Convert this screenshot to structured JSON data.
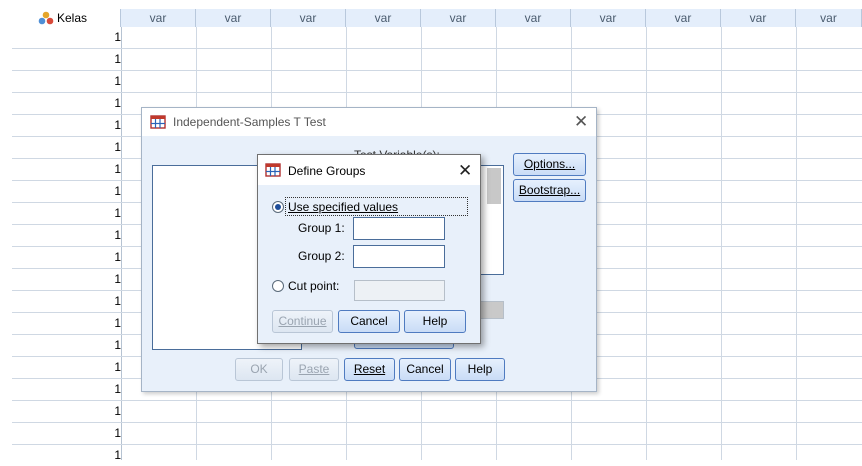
{
  "sheet": {
    "first_column_header": "Kelas",
    "first_column_icon": "nominal-variable-icon",
    "empty_column_headers": [
      "var",
      "var",
      "var",
      "var",
      "var",
      "var",
      "var",
      "var",
      "var",
      "var"
    ],
    "row_values": [
      "1",
      "1",
      "1",
      "1",
      "1",
      "1",
      "1",
      "1",
      "1",
      "1",
      "1",
      "1",
      "1",
      "1",
      "1",
      "1",
      "1",
      "1",
      "1",
      "1"
    ]
  },
  "main_dialog": {
    "title": "Independent-Samples T Test",
    "partial_label": "Test Variable(s):",
    "options_label": "Options...",
    "bootstrap_label": "Bootstrap...",
    "ok_label": "OK",
    "paste_label": "Paste",
    "reset_label": "Reset",
    "cancel_label": "Cancel",
    "help_label": "Help"
  },
  "define_groups": {
    "title": "Define Groups",
    "use_specified_label": "Use specified values",
    "group1_label": "Group 1:",
    "group1_value": "",
    "group2_label": "Group 2:",
    "group2_value": "",
    "cut_point_label": "Cut point:",
    "cut_point_value": "",
    "continue_label": "Continue",
    "cancel_label": "Cancel",
    "help_label": "Help"
  },
  "colors": {
    "header_bg": "#e4eefb",
    "dialog_bg": "#e8f0fa",
    "button_border": "#4f7bc0"
  }
}
